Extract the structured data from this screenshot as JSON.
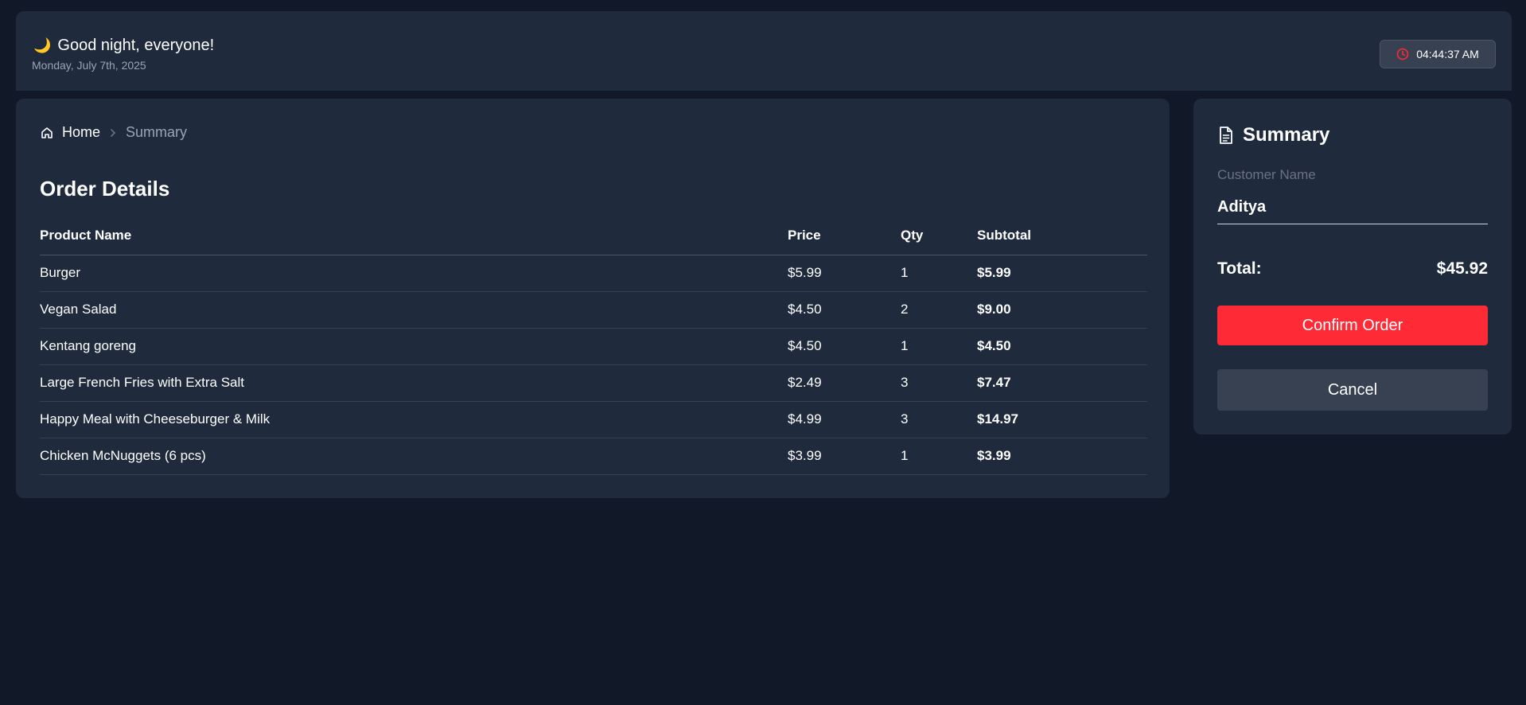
{
  "header": {
    "greeting": "Good night, everyone!",
    "greeting_icon": "moon-icon",
    "date": "Monday, July 7th, 2025",
    "time": "04:44:37 AM",
    "clock_icon": "clock-icon"
  },
  "breadcrumb": {
    "home_label": "Home",
    "current_label": "Summary"
  },
  "order": {
    "title": "Order Details",
    "columns": [
      "Product Name",
      "Price",
      "Qty",
      "Subtotal"
    ],
    "rows": [
      {
        "name": "Burger",
        "price": "$5.99",
        "qty": "1",
        "subtotal": "$5.99"
      },
      {
        "name": "Vegan Salad",
        "price": "$4.50",
        "qty": "2",
        "subtotal": "$9.00"
      },
      {
        "name": "Kentang goreng",
        "price": "$4.50",
        "qty": "1",
        "subtotal": "$4.50"
      },
      {
        "name": "Large French Fries with Extra Salt",
        "price": "$2.49",
        "qty": "3",
        "subtotal": "$7.47"
      },
      {
        "name": "Happy Meal with Cheeseburger & Milk",
        "price": "$4.99",
        "qty": "3",
        "subtotal": "$14.97"
      },
      {
        "name": "Chicken McNuggets (6 pcs)",
        "price": "$3.99",
        "qty": "1",
        "subtotal": "$3.99"
      }
    ]
  },
  "summary": {
    "title": "Summary",
    "customer_label": "Customer Name",
    "customer_value": "Aditya",
    "total_label": "Total:",
    "total_value": "$45.92",
    "confirm_label": "Confirm Order",
    "cancel_label": "Cancel"
  },
  "colors": {
    "background": "#111827",
    "card": "#1f2a3d",
    "accent": "#fe2b37",
    "muted": "#9aa4b2"
  }
}
